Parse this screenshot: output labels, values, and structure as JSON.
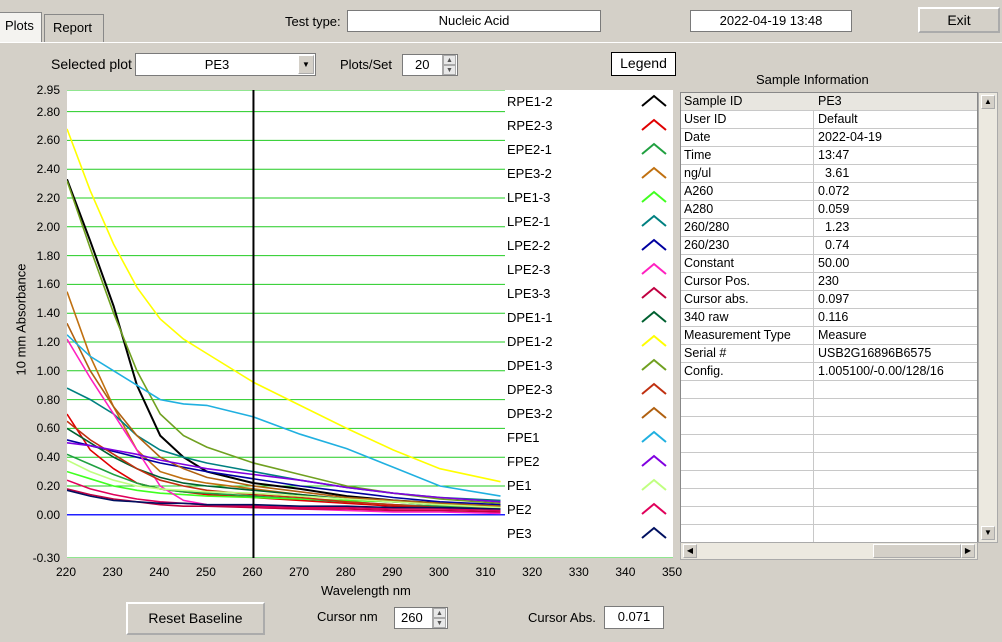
{
  "tabs": [
    {
      "label": "Plots"
    },
    {
      "label": "Report"
    }
  ],
  "header": {
    "test_type_label": "Test type:",
    "test_type_value": "Nucleic Acid",
    "datetime": "2022-04-19  13:48",
    "exit_label": "Exit"
  },
  "controls": {
    "selected_plot_label": "Selected plot",
    "selected_plot_value": "PE3",
    "plots_per_set_label": "Plots/Set",
    "plots_per_set_value": "20",
    "legend_label": "Legend",
    "reset_baseline_label": "Reset Baseline",
    "cursor_nm_label": "Cursor nm",
    "cursor_nm_value": "260",
    "cursor_abs_label": "Cursor Abs.",
    "cursor_abs_value": "0.071"
  },
  "sample_info": {
    "title": "Sample Information",
    "rows": [
      {
        "k": "Sample ID",
        "v": "PE3"
      },
      {
        "k": "User ID",
        "v": "Default"
      },
      {
        "k": "Date",
        "v": "2022-04-19"
      },
      {
        "k": "Time",
        "v": "13:47"
      },
      {
        "k": "ng/ul",
        "v": "  3.61"
      },
      {
        "k": "A260",
        "v": "0.072"
      },
      {
        "k": "A280",
        "v": "0.059"
      },
      {
        "k": "260/280",
        "v": "  1.23"
      },
      {
        "k": "260/230",
        "v": "  0.74"
      },
      {
        "k": "Constant",
        "v": "50.00"
      },
      {
        "k": "Cursor Pos.",
        "v": "230"
      },
      {
        "k": "Cursor abs.",
        "v": "0.097"
      },
      {
        "k": "340 raw",
        "v": "0.116"
      },
      {
        "k": "Measurement Type",
        "v": "Measure"
      },
      {
        "k": "Serial #",
        "v": "USB2G16896B6575"
      },
      {
        "k": "Config.",
        "v": "1.005100/-0.00/128/16"
      }
    ]
  },
  "chart_data": {
    "type": "line",
    "xlabel": "Wavelength nm",
    "ylabel": "10 mm Absorbance",
    "xlim": [
      220,
      350
    ],
    "ylim": [
      -0.3,
      2.95
    ],
    "x_ticks": [
      "220",
      "230",
      "240",
      "250",
      "260",
      "270",
      "280",
      "290",
      "300",
      "310",
      "320",
      "330",
      "340",
      "350"
    ],
    "y_ticks": [
      "2.95",
      "2.80",
      "2.60",
      "2.40",
      "2.20",
      "2.00",
      "1.80",
      "1.60",
      "1.40",
      "1.20",
      "1.00",
      "0.80",
      "0.60",
      "0.40",
      "0.20",
      "0.00",
      "-0.30"
    ],
    "cursor_x": 260,
    "x": [
      220,
      225,
      230,
      235,
      240,
      245,
      250,
      260,
      270,
      280,
      290,
      300,
      313
    ],
    "series": [
      {
        "name": "RPE1-2",
        "color": "#000000",
        "values": [
          2.33,
          1.9,
          1.45,
          0.9,
          0.55,
          0.4,
          0.3,
          0.22,
          0.18,
          0.13,
          0.1,
          0.08,
          0.05
        ]
      },
      {
        "name": "RPE2-3",
        "color": "#e00000",
        "values": [
          0.7,
          0.45,
          0.32,
          0.22,
          0.18,
          0.16,
          0.14,
          0.12,
          0.1,
          0.08,
          0.06,
          0.05,
          0.04
        ]
      },
      {
        "name": "EPE2-1",
        "color": "#20a040",
        "values": [
          0.42,
          0.35,
          0.28,
          0.22,
          0.18,
          0.16,
          0.15,
          0.13,
          0.11,
          0.09,
          0.07,
          0.06,
          0.05
        ]
      },
      {
        "name": "EPE3-2",
        "color": "#c07010",
        "values": [
          1.55,
          1.1,
          0.75,
          0.45,
          0.3,
          0.25,
          0.22,
          0.18,
          0.14,
          0.11,
          0.09,
          0.07,
          0.05
        ]
      },
      {
        "name": "LPE1-3",
        "color": "#40ff20",
        "values": [
          0.3,
          0.25,
          0.2,
          0.17,
          0.15,
          0.14,
          0.13,
          0.12,
          0.11,
          0.1,
          0.09,
          0.08,
          0.07
        ]
      },
      {
        "name": "LPE2-1",
        "color": "#008080",
        "values": [
          0.88,
          0.8,
          0.7,
          0.55,
          0.45,
          0.4,
          0.36,
          0.3,
          0.24,
          0.19,
          0.15,
          0.12,
          0.1
        ]
      },
      {
        "name": "LPE2-2",
        "color": "#0000a0",
        "values": [
          0.52,
          0.48,
          0.44,
          0.4,
          0.36,
          0.33,
          0.3,
          0.25,
          0.2,
          0.16,
          0.12,
          0.09,
          0.07
        ]
      },
      {
        "name": "LPE2-3",
        "color": "#ff20c0",
        "values": [
          1.22,
          0.95,
          0.7,
          0.45,
          0.2,
          0.1,
          0.07,
          0.05,
          0.04,
          0.03,
          0.02,
          0.02,
          0.01
        ]
      },
      {
        "name": "LPE3-3",
        "color": "#c00040",
        "values": [
          0.18,
          0.14,
          0.11,
          0.09,
          0.07,
          0.06,
          0.06,
          0.05,
          0.04,
          0.04,
          0.03,
          0.03,
          0.02
        ]
      },
      {
        "name": "DPE1-1",
        "color": "#006030",
        "values": [
          0.6,
          0.5,
          0.4,
          0.32,
          0.26,
          0.22,
          0.2,
          0.17,
          0.14,
          0.11,
          0.09,
          0.07,
          0.06
        ]
      },
      {
        "name": "DPE1-2",
        "color": "#ffff00",
        "values": [
          2.68,
          2.25,
          1.88,
          1.58,
          1.36,
          1.22,
          1.12,
          0.92,
          0.76,
          0.6,
          0.45,
          0.32,
          0.23
        ]
      },
      {
        "name": "DPE1-3",
        "color": "#70a020",
        "values": [
          2.32,
          1.85,
          1.4,
          1.0,
          0.7,
          0.55,
          0.47,
          0.36,
          0.28,
          0.2,
          0.15,
          0.11,
          0.08
        ]
      },
      {
        "name": "DPE2-3",
        "color": "#c03010",
        "values": [
          0.65,
          0.52,
          0.42,
          0.32,
          0.24,
          0.2,
          0.17,
          0.14,
          0.12,
          0.09,
          0.07,
          0.05,
          0.04
        ]
      },
      {
        "name": "DPE3-2",
        "color": "#b06010",
        "values": [
          1.33,
          1.0,
          0.75,
          0.55,
          0.4,
          0.32,
          0.26,
          0.2,
          0.16,
          0.12,
          0.1,
          0.08,
          0.06
        ]
      },
      {
        "name": "FPE1",
        "color": "#20b0e0",
        "values": [
          1.25,
          1.1,
          1.0,
          0.9,
          0.8,
          0.77,
          0.76,
          0.68,
          0.56,
          0.46,
          0.33,
          0.2,
          0.13
        ]
      },
      {
        "name": "FPE2",
        "color": "#8000e0",
        "values": [
          0.5,
          0.48,
          0.45,
          0.42,
          0.38,
          0.35,
          0.32,
          0.28,
          0.24,
          0.19,
          0.15,
          0.12,
          0.09
        ]
      },
      {
        "name": "PE1",
        "color": "#c0ff80",
        "values": [
          0.38,
          0.3,
          0.24,
          0.2,
          0.18,
          0.17,
          0.16,
          0.15,
          0.13,
          0.11,
          0.09,
          0.07,
          0.05
        ]
      },
      {
        "name": "PE2",
        "color": "#e0005a",
        "values": [
          0.24,
          0.18,
          0.14,
          0.11,
          0.09,
          0.08,
          0.07,
          0.06,
          0.05,
          0.05,
          0.04,
          0.04,
          0.03
        ]
      },
      {
        "name": "PE3",
        "color": "#001060",
        "values": [
          0.17,
          0.13,
          0.1,
          0.09,
          0.08,
          0.08,
          0.07,
          0.07,
          0.06,
          0.06,
          0.05,
          0.05,
          0.04
        ]
      }
    ]
  }
}
